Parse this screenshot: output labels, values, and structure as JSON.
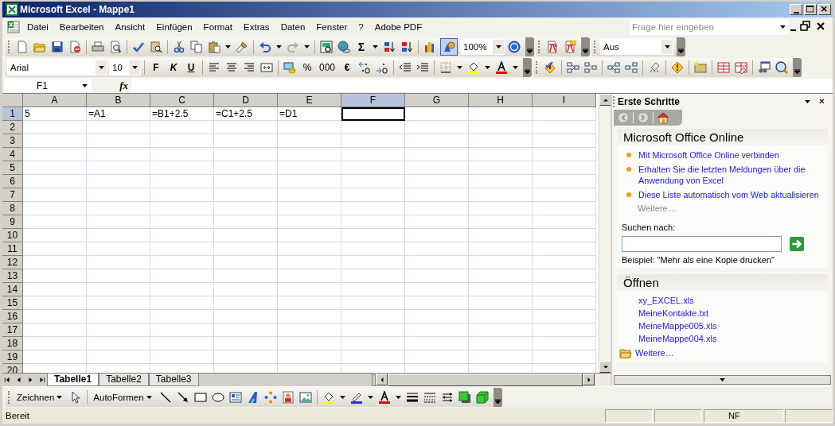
{
  "window": {
    "title": "Microsoft Excel - Mappe1"
  },
  "menu": {
    "items": [
      "Datei",
      "Bearbeiten",
      "Ansicht",
      "Einfügen",
      "Format",
      "Extras",
      "Daten",
      "Fenster",
      "?",
      "Adobe PDF"
    ],
    "help_field": {
      "placeholder": "Frage hier eingeben"
    }
  },
  "standard_toolbar": {
    "sigma": "Σ",
    "zoom": "100%",
    "drawing_toggle": {
      "pressed": true
    }
  },
  "view_toolbar": {
    "value": "Aus"
  },
  "formatting_toolbar": {
    "font": "Arial",
    "size": "10",
    "bold": "F",
    "italic": "K",
    "underline": "U",
    "percent": "%",
    "thousands": "000",
    "euro": "€"
  },
  "formula_bar": {
    "name_box": "F1",
    "function_button": "fx"
  },
  "sheet": {
    "columns": [
      {
        "label": "A",
        "selected": false
      },
      {
        "label": "B",
        "selected": false
      },
      {
        "label": "C",
        "selected": false
      },
      {
        "label": "D",
        "selected": false
      },
      {
        "label": "E",
        "selected": false
      },
      {
        "label": "F",
        "selected": true
      },
      {
        "label": "G",
        "selected": false
      },
      {
        "label": "H",
        "selected": false
      },
      {
        "label": "I",
        "selected": false
      }
    ],
    "rows": [
      {
        "label": "1",
        "selected": true,
        "cells": [
          {
            "text": "5",
            "selected": false
          },
          {
            "text": "=A1",
            "selected": false
          },
          {
            "text": "=B1+2.5",
            "selected": false
          },
          {
            "text": "=C1+2.5",
            "selected": false
          },
          {
            "text": "=D1",
            "selected": false
          },
          {
            "selected": true
          },
          {
            "selected": false
          },
          {
            "selected": false
          },
          {
            "selected": false
          }
        ]
      },
      {
        "label": "2",
        "selected": false
      },
      {
        "label": "3",
        "selected": false
      },
      {
        "label": "4",
        "selected": false
      },
      {
        "label": "5",
        "selected": false
      },
      {
        "label": "6",
        "selected": false
      },
      {
        "label": "7",
        "selected": false
      },
      {
        "label": "8",
        "selected": false
      },
      {
        "label": "9",
        "selected": false
      },
      {
        "label": "10",
        "selected": false
      },
      {
        "label": "11",
        "selected": false
      },
      {
        "label": "12",
        "selected": false
      },
      {
        "label": "13",
        "selected": false
      },
      {
        "label": "14",
        "selected": false
      },
      {
        "label": "15",
        "selected": false
      },
      {
        "label": "16",
        "selected": false
      },
      {
        "label": "17",
        "selected": false
      },
      {
        "label": "18",
        "selected": false
      },
      {
        "label": "19",
        "selected": false
      },
      {
        "label": "20",
        "selected": false
      }
    ],
    "tabs": [
      {
        "label": "Tabelle1",
        "selected": true
      },
      {
        "label": "Tabelle2",
        "selected": false
      },
      {
        "label": "Tabelle3",
        "selected": false
      }
    ]
  },
  "task_pane": {
    "title": "Erste Schritte",
    "online": {
      "heading": "Microsoft Office Online",
      "links": [
        "Mit Microsoft Office Online verbinden",
        "Erhalten Sie die letzten Meldungen über die Anwendung von Excel",
        "Diese Liste automatisch vom Web aktualisieren"
      ],
      "more": {
        "label": "Weitere…",
        "disabled": true
      },
      "search_label": "Suchen nach:",
      "example": "Beispiel:  \"Mehr als eine Kopie drucken\""
    },
    "open": {
      "heading": "Öffnen",
      "files": [
        "xy_EXCEL.xls",
        "MeineKontakte.txt",
        "MeineMappe005.xls",
        "MeineMappe004.xls"
      ],
      "more": {
        "label": "Weitere…",
        "disabled": false
      }
    }
  },
  "drawing_toolbar": {
    "draw_menu": "Zeichnen",
    "autoshapes_menu": "AutoFormen"
  },
  "status_bar": {
    "status": "Bereit",
    "indicator": "NF"
  }
}
